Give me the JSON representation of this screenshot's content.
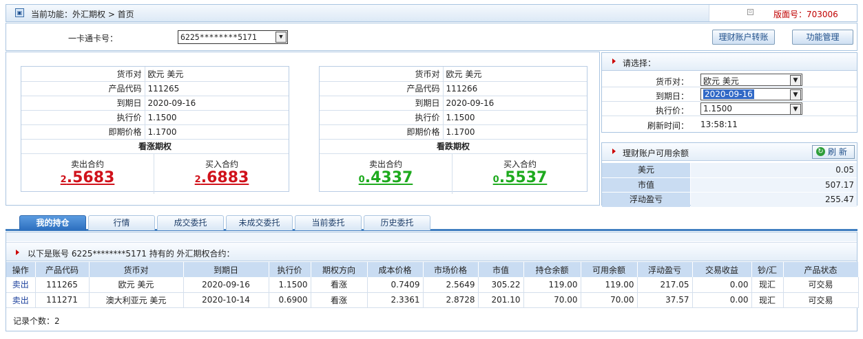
{
  "header": {
    "crumb": "当前功能：外汇期权 > 首页",
    "version_label": "版面号：703006"
  },
  "card": {
    "label": "一卡通卡号：",
    "selected": "6225********5171",
    "btn_transfer": "理财账户转账",
    "btn_manage": "功能管理"
  },
  "call_option": {
    "rows": [
      {
        "k": "货币对",
        "v": "欧元 美元"
      },
      {
        "k": "产品代码",
        "v": "111265"
      },
      {
        "k": "到期日",
        "v": "2020-09-16"
      },
      {
        "k": "执行价",
        "v": "1.1500"
      },
      {
        "k": "即期价格",
        "v": "1.1700"
      }
    ],
    "title": "看涨期权",
    "sell_label": "卖出合约",
    "sell_int": "2",
    "sell_dec": ".5683",
    "buy_label": "买入合约",
    "buy_int": "2",
    "buy_dec": ".6883"
  },
  "put_option": {
    "rows": [
      {
        "k": "货币对",
        "v": "欧元 美元"
      },
      {
        "k": "产品代码",
        "v": "111266"
      },
      {
        "k": "到期日",
        "v": "2020-09-16"
      },
      {
        "k": "执行价",
        "v": "1.1500"
      },
      {
        "k": "即期价格",
        "v": "1.1700"
      }
    ],
    "title": "看跌期权",
    "sell_label": "卖出合约",
    "sell_int": "0",
    "sell_dec": ".4337",
    "buy_label": "买入合约",
    "buy_int": "0",
    "buy_dec": ".5537"
  },
  "select_panel": {
    "title": "请选择：",
    "pair_label": "货币对：",
    "pair_value": "欧元 美元",
    "expiry_label": "到期日：",
    "expiry_value": "2020-09-16",
    "strike_label": "执行价：",
    "strike_value": "1.1500",
    "refresh_label": "刷新时间：",
    "refresh_value": "13:58:11"
  },
  "balance_panel": {
    "title": "理财账户可用余额",
    "refresh_btn": "刷 新",
    "rows": [
      {
        "k": "美元",
        "v": "0.05"
      },
      {
        "k": "市值",
        "v": "507.17"
      },
      {
        "k": "浮动盈亏",
        "v": "255.47"
      }
    ]
  },
  "tabs": [
    "我的持仓",
    "行情",
    "成交委托",
    "未成交委托",
    "当前委托",
    "历史委托"
  ],
  "holdings": {
    "title": "以下是账号 6225********5171 持有的 外汇期权合约：",
    "columns": [
      "操作",
      "产品代码",
      "货币对",
      "到期日",
      "执行价",
      "期权方向",
      "成本价格",
      "市场价格",
      "市值",
      "持仓余额",
      "可用余额",
      "浮动盈亏",
      "交易收益",
      "钞/汇",
      "产品状态"
    ],
    "rows": [
      [
        "卖出",
        "111265",
        "欧元 美元",
        "2020-09-16",
        "1.1500",
        "看涨",
        "0.7409",
        "2.5649",
        "305.22",
        "119.00",
        "119.00",
        "217.05",
        "0.00",
        "现汇",
        "可交易"
      ],
      [
        "卖出",
        "111271",
        "澳大利亚元 美元",
        "2020-10-14",
        "0.6900",
        "看涨",
        "2.3361",
        "2.8728",
        "201.10",
        "70.00",
        "70.00",
        "37.57",
        "0.00",
        "现汇",
        "可交易"
      ]
    ],
    "count_label": "记录个数：",
    "count_value": "2"
  }
}
